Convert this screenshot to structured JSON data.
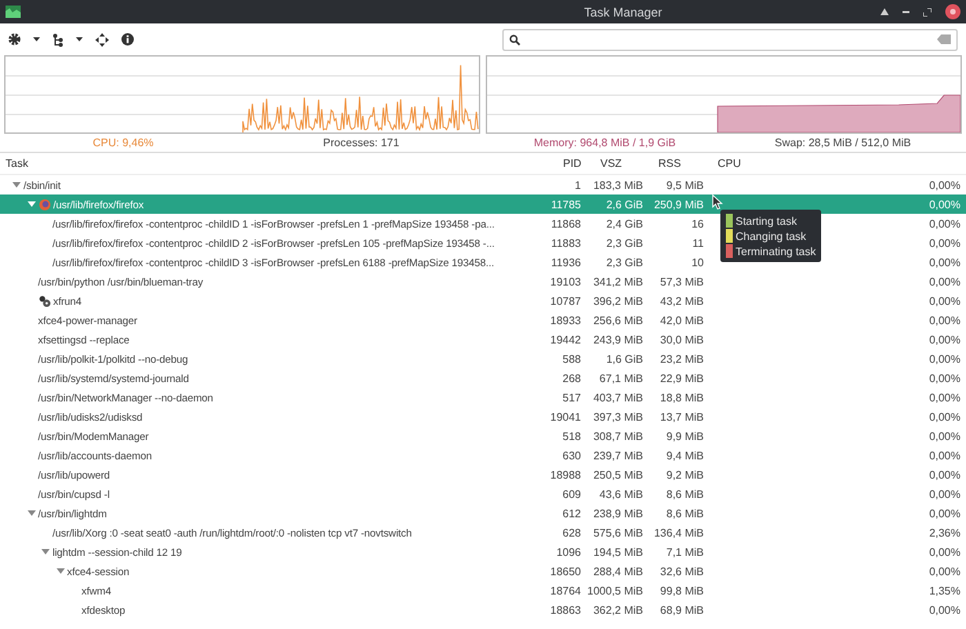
{
  "window": {
    "title": "Task Manager"
  },
  "monitors": [
    {
      "kind": "cpu",
      "labels": [
        {
          "text": "CPU: 9,46%",
          "kind": "cpu"
        },
        {
          "text": "Processes: 171",
          "kind": "plain"
        }
      ]
    },
    {
      "kind": "memory",
      "labels": [
        {
          "text": "Memory: 964,8 MiB / 1,9 GiB",
          "kind": "memory"
        },
        {
          "text": "Swap: 28,5 MiB / 512,0 MiB",
          "kind": "plain"
        }
      ]
    }
  ],
  "table": {
    "columns": [
      "Task",
      "PID",
      "VSZ",
      "RSS",
      "CPU"
    ],
    "rows": [
      {
        "name": "/sbin/init",
        "pid": "1",
        "vsz": "183,3 MiB",
        "rss": "9,5 MiB",
        "cpu": "0,00%",
        "selected": false,
        "expanded": true,
        "children": [
          {
            "name": "/usr/lib/firefox/firefox",
            "pid": "11785",
            "vsz": "2,6 GiB",
            "rss": "250,9 MiB",
            "cpu": "0,00%",
            "kind": "browser",
            "selected": true,
            "expanded": true,
            "children": [
              {
                "name": "/usr/lib/firefox/firefox -contentproc -childID 1 -isForBrowser -prefsLen 1 -prefMapSize 193458 -pa...",
                "pid": "11868",
                "vsz": "2,4 GiB",
                "rss": "16",
                "cpu": "0,00%",
                "selected": false
              },
              {
                "name": "/usr/lib/firefox/firefox -contentproc -childID 2 -isForBrowser -prefsLen 105 -prefMapSize 193458 -...",
                "pid": "11883",
                "vsz": "2,3 GiB",
                "rss": "11",
                "cpu": "0,00%",
                "selected": false
              },
              {
                "name": "/usr/lib/firefox/firefox -contentproc -childID 3 -isForBrowser -prefsLen 6188 -prefMapSize 193458...",
                "pid": "11936",
                "vsz": "2,3 GiB",
                "rss": "10",
                "cpu": "0,00%",
                "selected": false
              }
            ]
          },
          {
            "name": "/usr/bin/python /usr/bin/blueman-tray",
            "pid": "19103",
            "vsz": "341,2 MiB",
            "rss": "57,3 MiB",
            "cpu": "0,00%",
            "selected": false
          },
          {
            "name": "xfrun4",
            "pid": "10787",
            "vsz": "396,2 MiB",
            "rss": "43,2 MiB",
            "cpu": "0,00%",
            "kind": "launcher",
            "selected": false
          },
          {
            "name": "xfce4-power-manager",
            "pid": "18933",
            "vsz": "256,6 MiB",
            "rss": "42,0 MiB",
            "cpu": "0,00%",
            "selected": false
          },
          {
            "name": "xfsettingsd --replace",
            "pid": "19442",
            "vsz": "243,9 MiB",
            "rss": "30,0 MiB",
            "cpu": "0,00%",
            "selected": false
          },
          {
            "name": "/usr/lib/polkit-1/polkitd --no-debug",
            "pid": "588",
            "vsz": "1,6 GiB",
            "rss": "23,2 MiB",
            "cpu": "0,00%",
            "selected": false
          },
          {
            "name": "/usr/lib/systemd/systemd-journald",
            "pid": "268",
            "vsz": "67,1 MiB",
            "rss": "22,9 MiB",
            "cpu": "0,00%",
            "selected": false
          },
          {
            "name": "/usr/bin/NetworkManager --no-daemon",
            "pid": "517",
            "vsz": "403,7 MiB",
            "rss": "18,8 MiB",
            "cpu": "0,00%",
            "selected": false
          },
          {
            "name": "/usr/lib/udisks2/udisksd",
            "pid": "19041",
            "vsz": "397,3 MiB",
            "rss": "13,7 MiB",
            "cpu": "0,00%",
            "selected": false
          },
          {
            "name": "/usr/bin/ModemManager",
            "pid": "518",
            "vsz": "308,7 MiB",
            "rss": "9,9 MiB",
            "cpu": "0,00%",
            "selected": false
          },
          {
            "name": "/usr/lib/accounts-daemon",
            "pid": "630",
            "vsz": "239,7 MiB",
            "rss": "9,4 MiB",
            "cpu": "0,00%",
            "selected": false
          },
          {
            "name": "/usr/lib/upowerd",
            "pid": "18988",
            "vsz": "250,5 MiB",
            "rss": "9,2 MiB",
            "cpu": "0,00%",
            "selected": false
          },
          {
            "name": "/usr/bin/cupsd -l",
            "pid": "609",
            "vsz": "43,6 MiB",
            "rss": "8,6 MiB",
            "cpu": "0,00%",
            "selected": false
          },
          {
            "name": "/usr/bin/lightdm",
            "pid": "612",
            "vsz": "238,9 MiB",
            "rss": "8,6 MiB",
            "cpu": "0,00%",
            "selected": false,
            "expanded": true,
            "children": [
              {
                "name": "/usr/lib/Xorg :0 -seat seat0 -auth /run/lightdm/root/:0 -nolisten tcp vt7 -novtswitch",
                "pid": "628",
                "vsz": "575,6 MiB",
                "rss": "136,4 MiB",
                "cpu": "2,36%",
                "selected": false
              },
              {
                "name": "lightdm --session-child 12 19",
                "pid": "1096",
                "vsz": "194,5 MiB",
                "rss": "7,1 MiB",
                "cpu": "0,00%",
                "selected": false,
                "expanded": true,
                "children": [
                  {
                    "name": "xfce4-session",
                    "pid": "18650",
                    "vsz": "288,4 MiB",
                    "rss": "32,6 MiB",
                    "cpu": "0,00%",
                    "selected": false,
                    "expanded": true,
                    "children": [
                      {
                        "name": "xfwm4",
                        "pid": "18764",
                        "vsz": "1000,5 MiB",
                        "rss": "99,8 MiB",
                        "cpu": "1,35%",
                        "selected": false
                      },
                      {
                        "name": "xfdesktop",
                        "pid": "18863",
                        "vsz": "362,2 MiB",
                        "rss": "68,9 MiB",
                        "cpu": "0,00%",
                        "selected": false
                      }
                    ]
                  }
                ]
              }
            ]
          }
        ]
      }
    ]
  },
  "legend": [
    {
      "label": "Starting task",
      "color": "#9bc45c"
    },
    {
      "label": "Changing task",
      "color": "#e3dc5a"
    },
    {
      "label": "Terminating task",
      "color": "#d9605e"
    }
  ]
}
